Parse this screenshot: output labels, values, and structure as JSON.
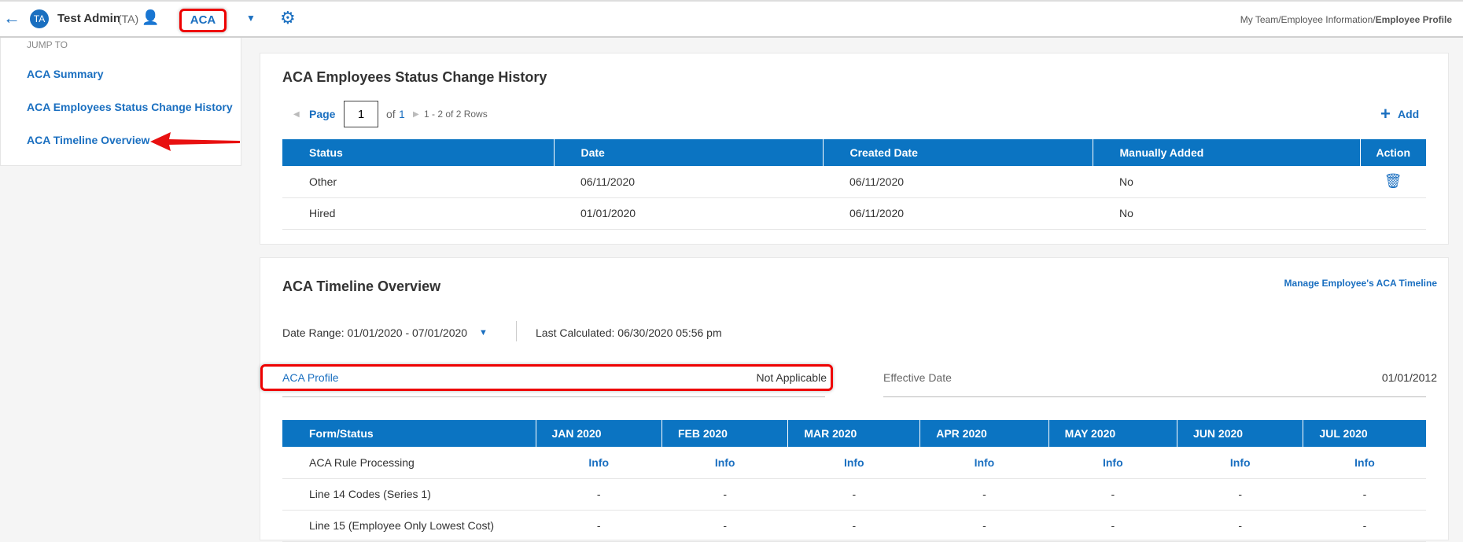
{
  "header": {
    "user_initials": "TA",
    "user_name": "Test Admin",
    "user_abbr": "(TA)",
    "module": "ACA",
    "breadcrumb_path": "My Team/Employee Information/",
    "breadcrumb_current": "Employee Profile"
  },
  "sidebar": {
    "heading": "JUMP TO",
    "items": [
      {
        "label": "ACA Summary"
      },
      {
        "label": "ACA Employees Status Change History"
      },
      {
        "label": "ACA Timeline Overview"
      }
    ]
  },
  "status_history": {
    "title": "ACA Employees Status Change History",
    "page_label": "Page",
    "page_value": "1",
    "of_label": "of",
    "total_pages": "1",
    "rows_info": "1 - 2 of 2 Rows",
    "add_label": "Add",
    "columns": [
      "Status",
      "Date",
      "Created Date",
      "Manually Added",
      "Action"
    ],
    "rows": [
      {
        "status": "Other",
        "date": "06/11/2020",
        "created": "06/11/2020",
        "manual": "No"
      },
      {
        "status": "Hired",
        "date": "01/01/2020",
        "created": "06/11/2020",
        "manual": "No"
      }
    ]
  },
  "timeline": {
    "title": "ACA Timeline Overview",
    "manage_link": "Manage Employee's ACA Timeline",
    "date_range": "Date Range: 01/01/2020 - 07/01/2020",
    "last_calculated": "Last Calculated: 06/30/2020 05:56 pm",
    "profile_label": "ACA Profile",
    "profile_value": "Not Applicable",
    "effective_label": "Effective Date",
    "effective_value": "01/01/2012",
    "columns": [
      "Form/Status",
      "JAN 2020",
      "FEB 2020",
      "MAR 2020",
      "APR 2020",
      "MAY 2020",
      "JUN 2020",
      "JUL 2020"
    ],
    "rows": [
      {
        "label": "ACA Rule Processing",
        "cells": [
          "Info",
          "Info",
          "Info",
          "Info",
          "Info",
          "Info",
          "Info"
        ]
      },
      {
        "label": "Line 14 Codes (Series 1)",
        "cells": [
          "-",
          "-",
          "-",
          "-",
          "-",
          "-",
          "-"
        ]
      },
      {
        "label": "Line 15 (Employee Only Lowest Cost)",
        "cells": [
          "-",
          "-",
          "-",
          "-",
          "-",
          "-",
          "-"
        ]
      }
    ]
  }
}
